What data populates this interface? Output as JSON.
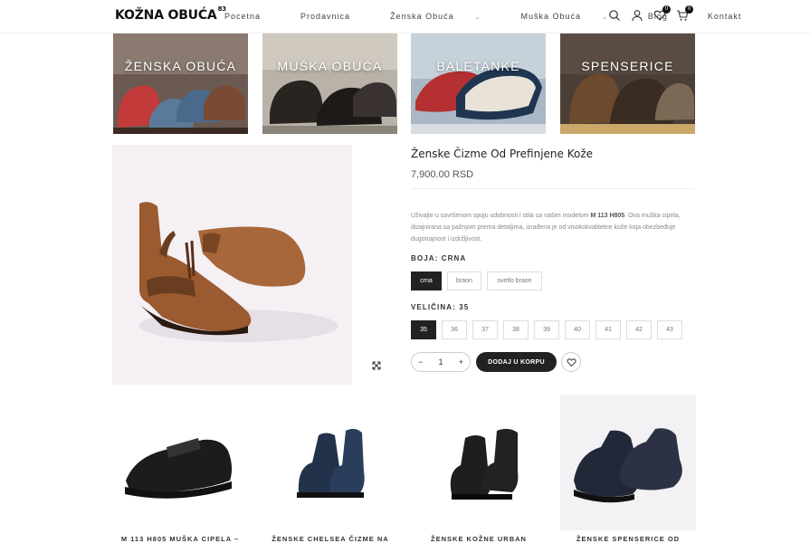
{
  "header": {
    "logo_text": "KOŽNA OBUĆA",
    "logo_sup": "83",
    "nav": [
      {
        "label": "Pocetna",
        "caret": ""
      },
      {
        "label": "Prodavnica",
        "caret": ""
      },
      {
        "label": "Ženska Obuća",
        "caret": "⌄"
      },
      {
        "label": "Muška Obuća",
        "caret": "⌄"
      },
      {
        "label": "Blog",
        "caret": ""
      },
      {
        "label": "Kontakt",
        "caret": ""
      }
    ],
    "wishlist_count": "0",
    "cart_count": "0",
    "icons": [
      "search-icon",
      "user-icon",
      "heart-icon",
      "cart-icon"
    ]
  },
  "categories": [
    {
      "label": "ŽENSKA OBUĆA"
    },
    {
      "label": "MUŠKA OBUĆA"
    },
    {
      "label": "BALETANKE"
    },
    {
      "label": "SPENSERICE"
    }
  ],
  "product": {
    "title": "Ženske Čizme Od Prefinjene Kože",
    "price": "7,900.00 RSD",
    "desc_pre": "Uživajte u savršenom spoju udobnosti i stila sa našim modelom ",
    "desc_model": "M 113 H805",
    "desc_post": ". Ova muška cipela, dizajnirana sa pažnjom prema detaljima, izrađena je od visokokvalitetne kože koja obezbeđuje dugotrajnost i izdržljivost.",
    "color_label": "BOJA: CRNA",
    "colors": [
      "crna",
      "braon",
      "svetlo braon"
    ],
    "size_label": "VELIČINA: 35",
    "sizes": [
      "35",
      "36",
      "37",
      "38",
      "39",
      "40",
      "41",
      "42",
      "43"
    ],
    "quantity": "1",
    "minus": "−",
    "plus": "+",
    "add_to_cart": "DODAJ U KORPU"
  },
  "related": [
    {
      "title": "M 113 H805 MUŠKA CIPELA –"
    },
    {
      "title": "ŽENSKE CHELSEA ČIZME NA"
    },
    {
      "title": "ŽENSKE KOŽNE URBAN"
    },
    {
      "title": "ŽENSKE SPENSERICE OD"
    }
  ]
}
